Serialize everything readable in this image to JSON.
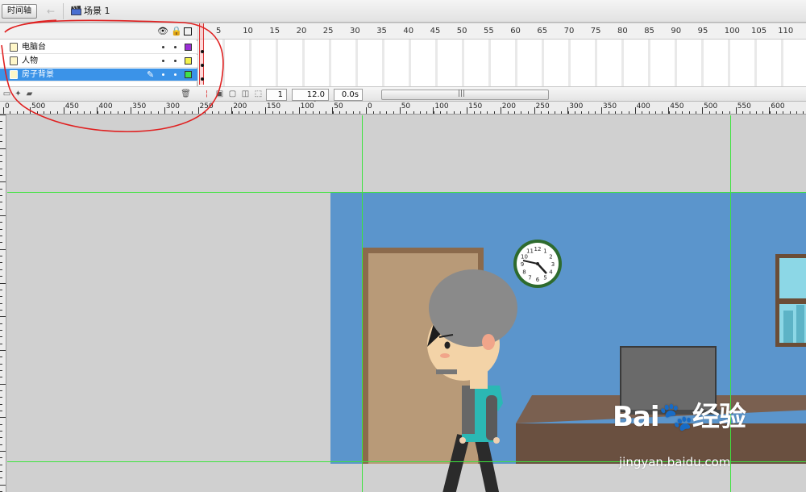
{
  "topbar": {
    "timeline_tab": "时间轴",
    "back_icon": "back-arrow-icon",
    "scene_icon": "clapperboard-icon",
    "scene_label": "场景 1"
  },
  "layers": [
    {
      "name": "电脑台",
      "color": "#9b2fd6",
      "selected": false
    },
    {
      "name": "人物",
      "color": "#f2f24c",
      "selected": false
    },
    {
      "name": "房子背景",
      "color": "#3fe14b",
      "selected": true
    }
  ],
  "layer_header_icons": [
    "eye-icon",
    "lock-icon",
    "outline-icon"
  ],
  "frame_numbers": [
    "5",
    "10",
    "15",
    "20",
    "25",
    "30",
    "35",
    "40",
    "45",
    "50",
    "55",
    "60",
    "65",
    "70",
    "75",
    "80",
    "85",
    "90",
    "95",
    "100",
    "105",
    "110"
  ],
  "timeline_toolbar": {
    "current_frame": "1",
    "frame_rate": "12.0 fps",
    "elapsed_time": "0.0s"
  },
  "h_ruler_labels": [
    "0",
    "500",
    "450",
    "400",
    "350",
    "300",
    "250",
    "200",
    "150",
    "100",
    "50",
    "0",
    "50",
    "100",
    "150",
    "200",
    "250",
    "300",
    "350",
    "400",
    "450",
    "500",
    "550",
    "600"
  ],
  "clock_numbers": [
    "12",
    "1",
    "2",
    "3",
    "4",
    "5",
    "6",
    "7",
    "8",
    "9",
    "10",
    "11"
  ],
  "watermark": {
    "logo": "Bai🐾经验",
    "url": "jingyan.baidu.com"
  },
  "colors": {
    "selected_layer": "#3b93e8",
    "guide_line": "#3ee33e",
    "annotation": "#e02020",
    "wall": "#5b95cc",
    "door": "#b89a78",
    "desk": "#7a6050"
  }
}
